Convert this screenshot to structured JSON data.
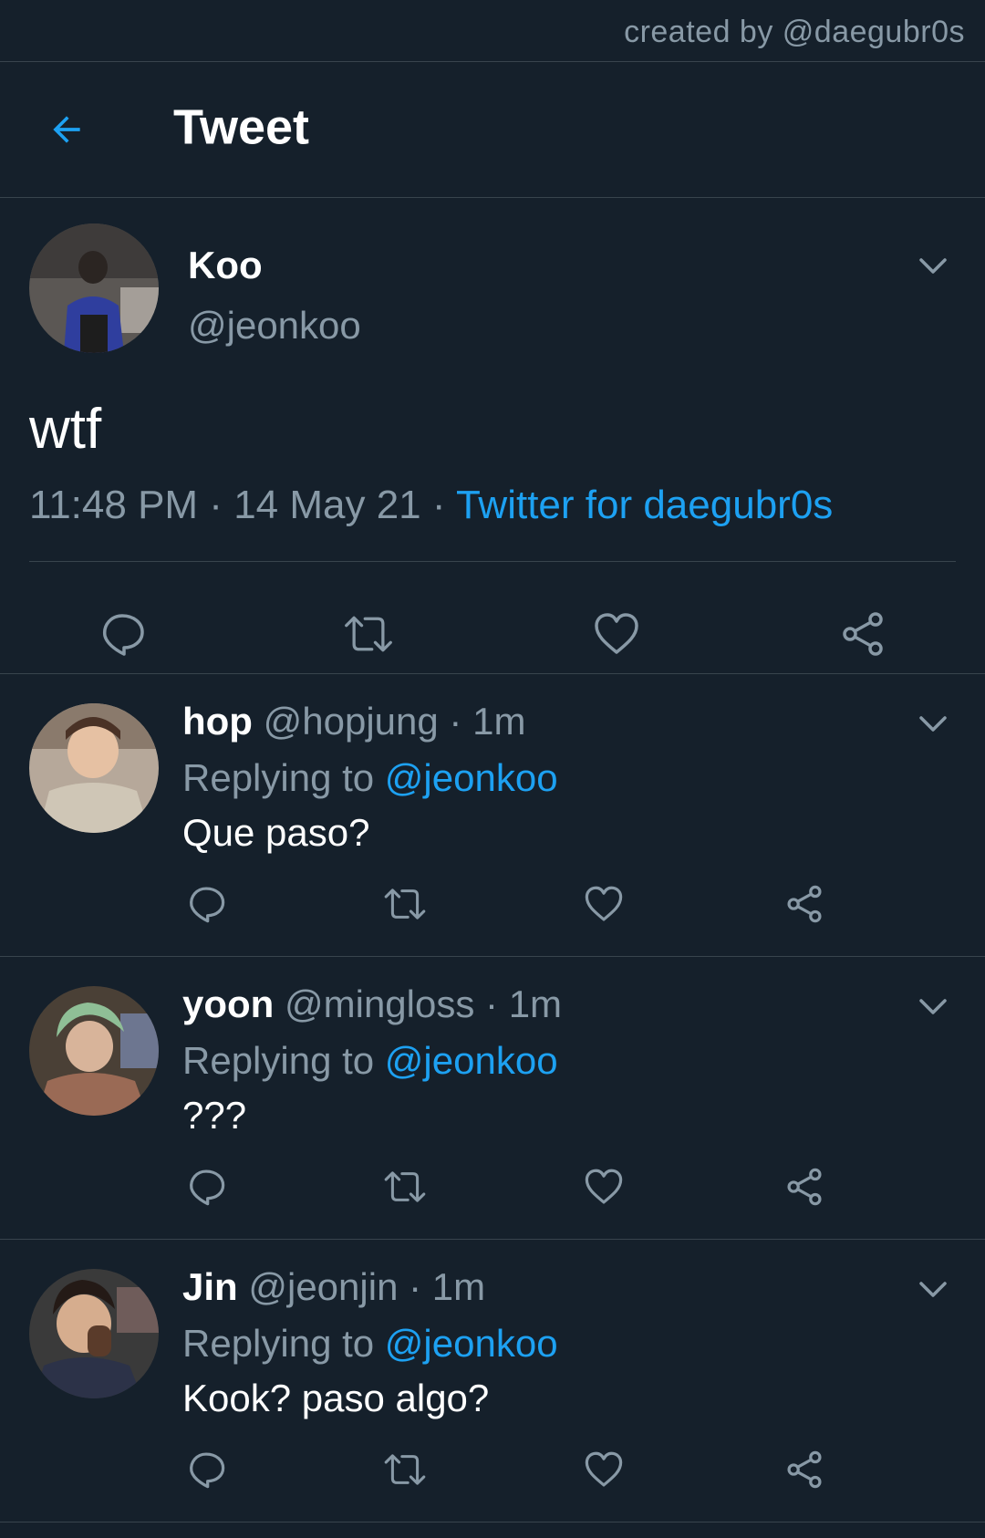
{
  "credit": "created by @daegubr0s",
  "header": {
    "title": "Tweet",
    "back_icon": "arrow-left-icon"
  },
  "colors": {
    "background": "#15202b",
    "accent": "#1da1f2",
    "muted": "#8899a6",
    "border": "#38444d"
  },
  "tweet": {
    "name": "Koo",
    "handle": "@jeonkoo",
    "text": "wtf",
    "time": "11:48 PM",
    "date": "14 May 21",
    "source": "Twitter for daegubr0s",
    "sep": " · "
  },
  "replies": [
    {
      "name": "hop",
      "handle": "@hopjung",
      "age": "1m",
      "replying_label": "Replying to",
      "mention": "@jeonkoo",
      "text": "Que paso?"
    },
    {
      "name": "yoon",
      "handle": "@mingloss",
      "age": "1m",
      "replying_label": "Replying to",
      "mention": "@jeonkoo",
      "text": "???"
    },
    {
      "name": "Jin",
      "handle": "@jeonjin",
      "age": "1m",
      "replying_label": "Replying to",
      "mention": "@jeonkoo",
      "text": "Kook? paso algo?"
    }
  ],
  "icons": [
    "reply-icon",
    "retweet-icon",
    "like-icon",
    "share-icon",
    "chevron-down-icon"
  ]
}
